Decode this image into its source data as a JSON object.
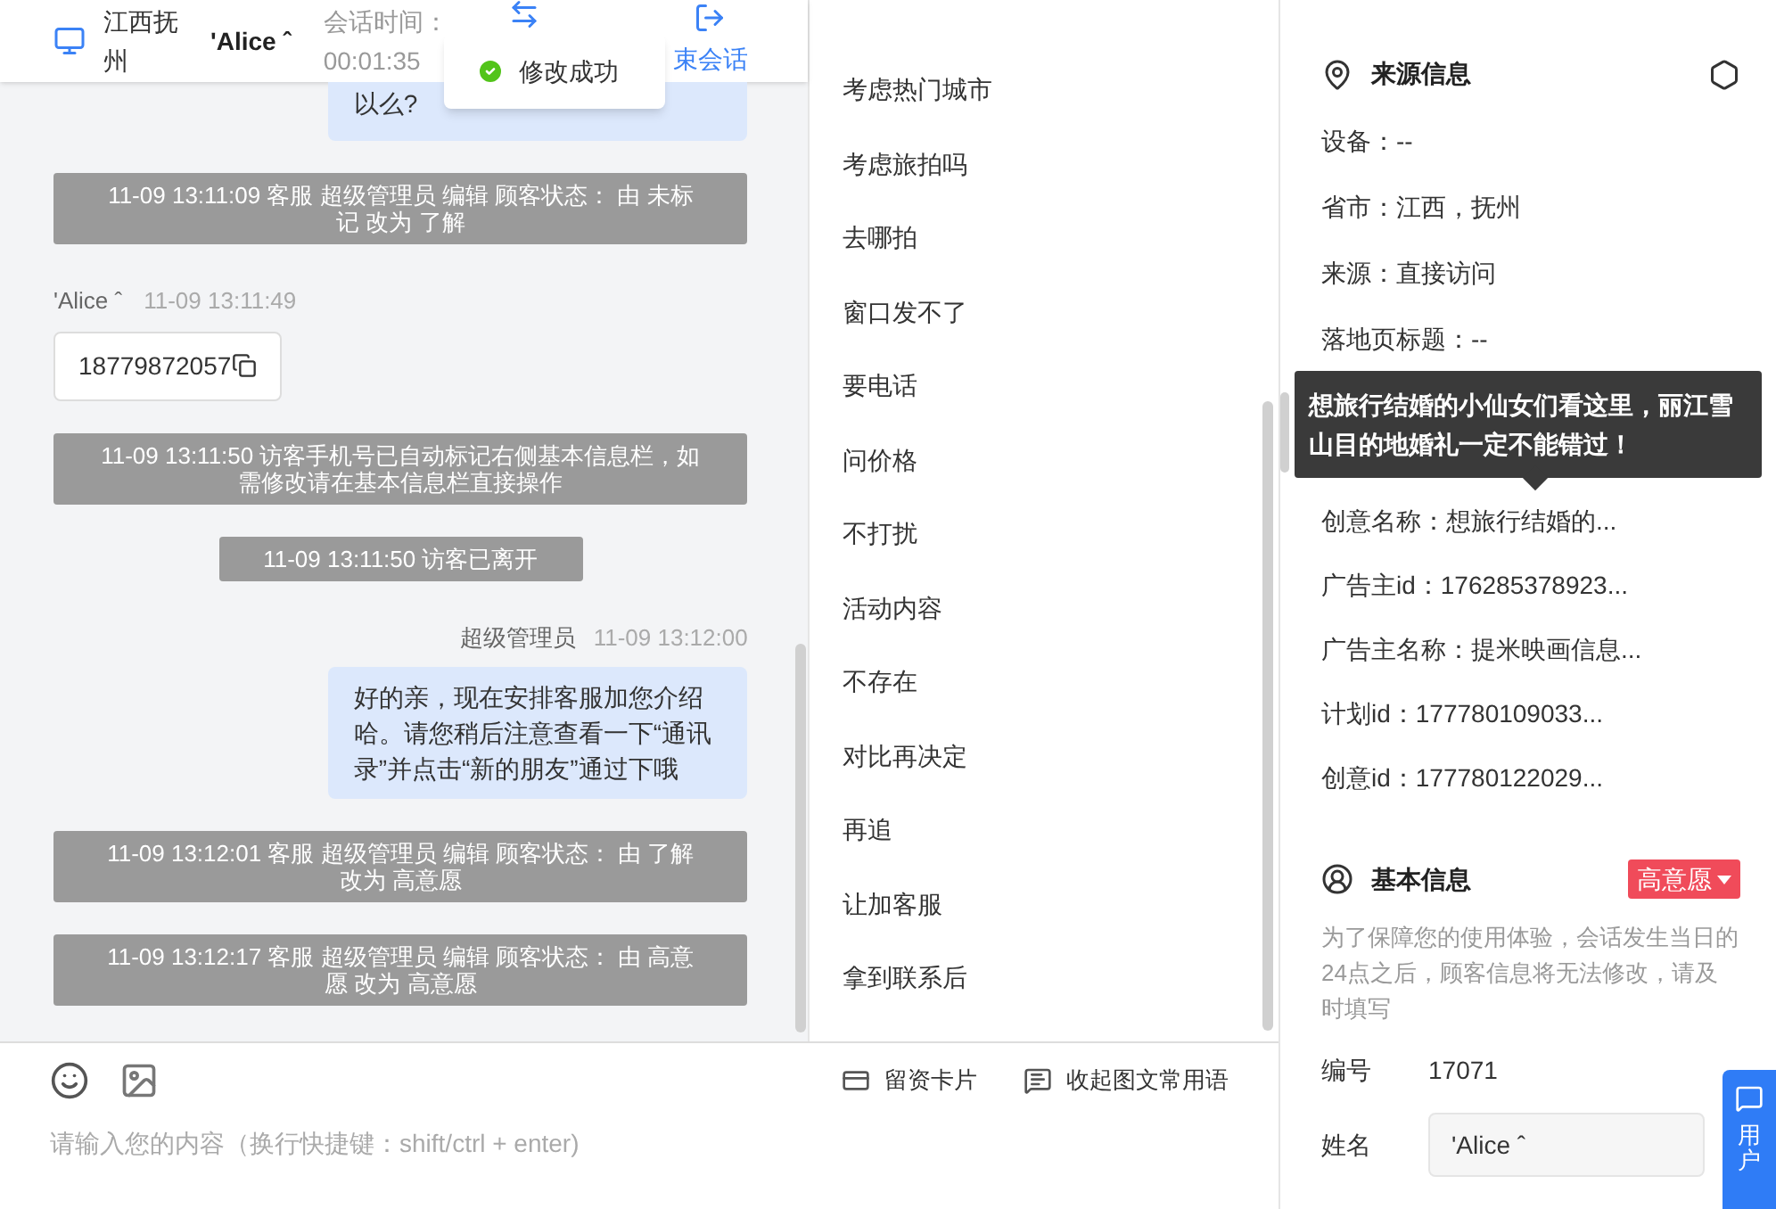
{
  "header": {
    "location": "江西抚州",
    "visitor": "'Alice ˆ",
    "session_time_label": "会话时间：",
    "session_time": "00:01:35",
    "end_label": "束会话"
  },
  "toast": {
    "text": "修改成功"
  },
  "messages": [
    {
      "kind": "agent_partial",
      "text": "以么?"
    },
    {
      "kind": "system",
      "text": "11-09 13:11:09 客服 超级管理员 编辑 顾客状态： 由 未标记 改为 了解"
    },
    {
      "kind": "visitor",
      "name": "'Alice ˆ",
      "time": "11-09 13:11:49",
      "text": "18779872057"
    },
    {
      "kind": "system",
      "text": "11-09 13:11:50 访客手机号已自动标记右侧基本信息栏，如需修改请在基本信息栏直接操作"
    },
    {
      "kind": "system",
      "text": "11-09 13:11:50 访客已离开"
    },
    {
      "kind": "agent",
      "name": "超级管理员",
      "time": "11-09 13:12:00",
      "text": "好的亲，现在安排客服加您介绍哈。请您稍后注意查看一下“通讯录”并点击“新的朋友”通过下哦"
    },
    {
      "kind": "system",
      "text": "11-09 13:12:01 客服 超级管理员 编辑 顾客状态： 由 了解改为 高意愿"
    },
    {
      "kind": "system",
      "text": "11-09 13:12:17 客服 超级管理员 编辑 顾客状态： 由 高意愿 改为 高意愿"
    }
  ],
  "phrases": [
    "考虑热门城市",
    "考虑旅拍吗",
    "去哪拍",
    "窗口发不了",
    "要电话",
    "问价格",
    "不打扰",
    "活动内容",
    "不存在",
    "对比再决定",
    "再追",
    "让加客服",
    "拿到联系后"
  ],
  "toolbar": {
    "tools": [
      {
        "kind": "card",
        "label": "留资卡片"
      },
      {
        "kind": "collapse",
        "label": "收起图文常用语"
      }
    ]
  },
  "input": {
    "placeholder": "请输入您的内容（换行快捷键：shift/ctrl + enter)"
  },
  "source_info": {
    "title": "来源信息",
    "fields": [
      "设备：--",
      "省市：江西，抚州",
      "来源：直接访问",
      "落地页标题：--"
    ],
    "tooltip": "想旅行结婚的小仙女们看这里，丽江雪山目的地婚礼一定不能错过！",
    "more_fields": [
      "创意名称：想旅行结婚的...",
      "广告主id：176285378923...",
      "广告主名称：提米映画信息...",
      "计划id：177780109033...",
      "创意id：177780122029..."
    ]
  },
  "basic_info": {
    "title": "基本信息",
    "status": "高意愿",
    "notice": "为了保障您的使用体验，会话发生当日的24点之后，顾客信息将无法修改，请及时填写",
    "fields": [
      {
        "kind": "text",
        "label": "编号",
        "value": "17071"
      },
      {
        "kind": "input",
        "label": "姓名",
        "value": "'Alice ˆ"
      }
    ]
  },
  "feedback": {
    "label": "用户"
  }
}
